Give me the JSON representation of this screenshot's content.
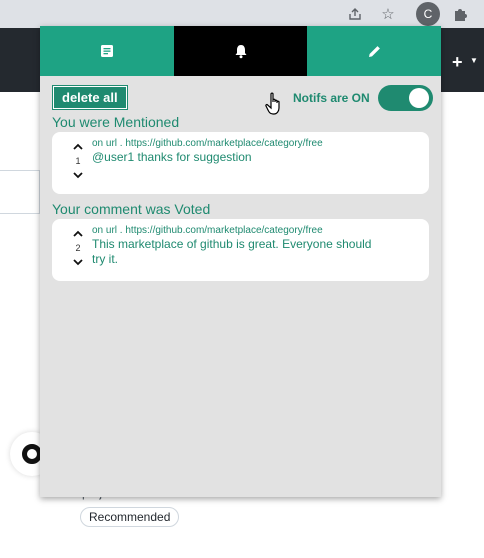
{
  "browser": {
    "avatar_letter": "C",
    "icons": [
      "share-icon",
      "star-icon",
      "puzzle-icon"
    ]
  },
  "popup": {
    "tabs": [
      {
        "name": "notes-tab",
        "icon": "document-icon",
        "active": false
      },
      {
        "name": "notifications-tab",
        "icon": "bell-icon",
        "active": true
      },
      {
        "name": "edit-tab",
        "icon": "pencil-icon",
        "active": false
      }
    ],
    "delete_all_label": "delete all",
    "notifs_label": "Notifs are ON",
    "notifs_on": true,
    "sections": [
      {
        "title": "You were Mentioned",
        "card": {
          "vote_count": "1",
          "url": "on url . https://github.com/marketplace/category/free",
          "text": "@user1 thanks for suggestion"
        }
      },
      {
        "title": "Your comment was Voted",
        "card": {
          "vote_count": "2",
          "url": "on url . https://github.com/marketplace/category/free",
          "text": "This marketplace of github is great. Everyone should try it."
        }
      }
    ]
  },
  "background": {
    "text": "projects in minutes",
    "badge": "Recommended"
  },
  "colors": {
    "accent": "#1ea384",
    "accent_dark": "#1f8a70",
    "popup_bg": "#e2e2e2",
    "active_tab": "#000000"
  }
}
